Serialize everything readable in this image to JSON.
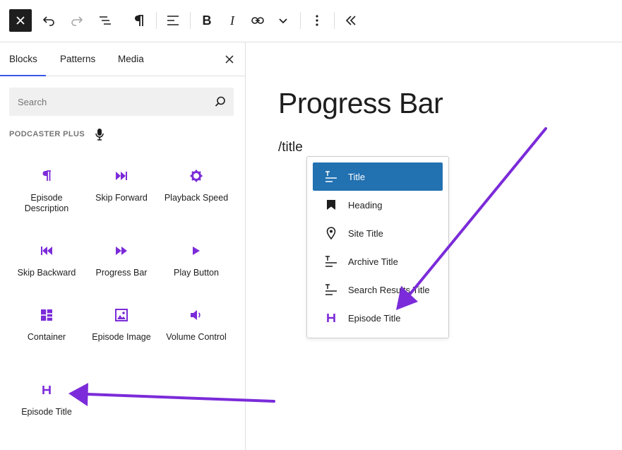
{
  "toolbar": {
    "close": "close-icon",
    "undo": "undo-icon",
    "redo": "redo-icon",
    "list_view": "list-view-icon",
    "paragraph": "paragraph-icon",
    "align": "align-left-icon",
    "bold": "B",
    "italic": "I",
    "link": "link-icon",
    "more": "chevron-down-icon",
    "options": "more-vertical-icon",
    "collapse": "chevron-double-left-icon"
  },
  "sidebar": {
    "tabs": [
      {
        "label": "Blocks"
      },
      {
        "label": "Patterns"
      },
      {
        "label": "Media"
      }
    ],
    "search_placeholder": "Search",
    "category": "PODCASTER PLUS",
    "blocks": [
      {
        "label": "Episode Description",
        "icon": "paragraph-icon"
      },
      {
        "label": "Skip Forward",
        "icon": "skip-forward-icon"
      },
      {
        "label": "Playback Speed",
        "icon": "gear-icon"
      },
      {
        "label": "Skip Backward",
        "icon": "skip-backward-icon"
      },
      {
        "label": "Progress Bar",
        "icon": "fast-forward-icon"
      },
      {
        "label": "Play Button",
        "icon": "play-icon"
      },
      {
        "label": "Container",
        "icon": "container-icon"
      },
      {
        "label": "Episode Image",
        "icon": "image-icon"
      },
      {
        "label": "Volume Control",
        "icon": "volume-icon"
      },
      {
        "label": "Episode Title",
        "icon": "heading-h-icon"
      }
    ]
  },
  "editor": {
    "title": "Progress Bar",
    "command": "/title"
  },
  "autocomplete": {
    "options": [
      {
        "label": "Title",
        "icon": "title-icon"
      },
      {
        "label": "Heading",
        "icon": "bookmark-icon"
      },
      {
        "label": "Site Title",
        "icon": "map-pin-icon"
      },
      {
        "label": "Archive Title",
        "icon": "title-icon"
      },
      {
        "label": "Search Results Title",
        "icon": "title-icon"
      },
      {
        "label": "Episode Title",
        "icon": "heading-h-icon"
      }
    ]
  },
  "colors": {
    "accent_purple": "#7b2bd9",
    "selected_blue": "#2271b1",
    "tab_underline": "#3858e9"
  }
}
